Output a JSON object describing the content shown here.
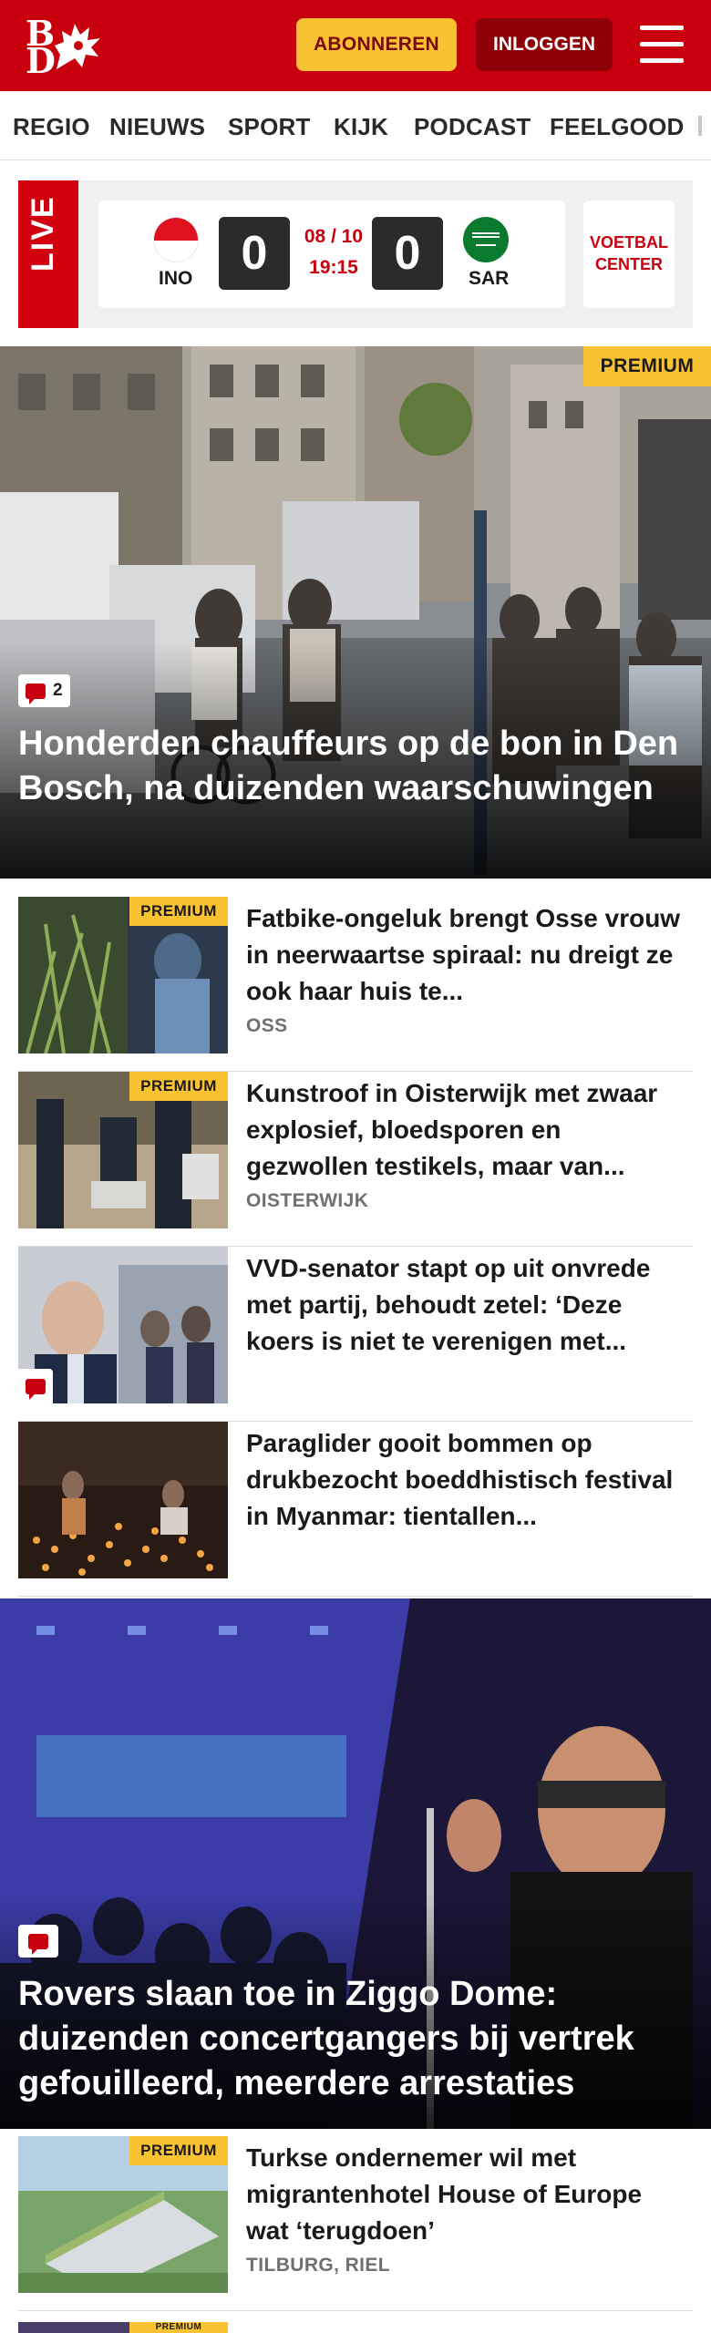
{
  "brand": {
    "logo_alt": "BD",
    "primary_color": "#c8000e",
    "accent_color": "#f9c232"
  },
  "header": {
    "subscribe_label": "ABONNEREN",
    "login_label": "INLOGGEN",
    "menu_icon": "hamburger-icon"
  },
  "nav": {
    "items": [
      "REGIO",
      "NIEUWS",
      "SPORT",
      "KIJK",
      "PODCAST",
      "FEELGOOD"
    ]
  },
  "live": {
    "tag": "LIVE",
    "home_team": "INO",
    "away_team": "SAR",
    "home_score": "0",
    "away_score": "0",
    "date": "08 / 10",
    "time": "19:15",
    "voetbal_center": "VOETBAL CENTER"
  },
  "hero1": {
    "premium": "PREMIUM",
    "comments": "2",
    "headline": "Honderden chauffeurs op de bon in Den Bosch, na duizenden waarschu­wingen"
  },
  "articles": [
    {
      "premium": "PREMIUM",
      "title": "Fatbike-ongeluk brengt Osse vrouw in neerwaartse spiraal: nu dreigt ze ook haar huis te...",
      "location": "OSS"
    },
    {
      "premium": "PREMIUM",
      "title": "Kunstroof in Oisterwijk met zwaar explosief, bloedsporen en gezwollen testikels, maar van...",
      "location": "OISTERWIJK"
    },
    {
      "title": "VVD-senator stapt op uit onvrede met partij, behoudt zetel: ‘Deze koers is niet te verenigen met...",
      "location": ""
    },
    {
      "title": "Paraglider gooit bommen op drukbezocht boeddhistisch festival in Myanmar: tientallen...",
      "location": ""
    }
  ],
  "hero2": {
    "headline": "Rovers slaan toe in Ziggo Dome: duizenden concertgangers bij vertrek gefouilleerd, meerdere arrestaties"
  },
  "articles2": [
    {
      "premium": "PREMIUM",
      "title": "Turkse ondernemer wil met migrantenhotel House of Europe wat ‘terugdoen’",
      "location": "TILBURG, RIEL"
    }
  ],
  "partial_article": {
    "premium": "PREMIUM"
  }
}
